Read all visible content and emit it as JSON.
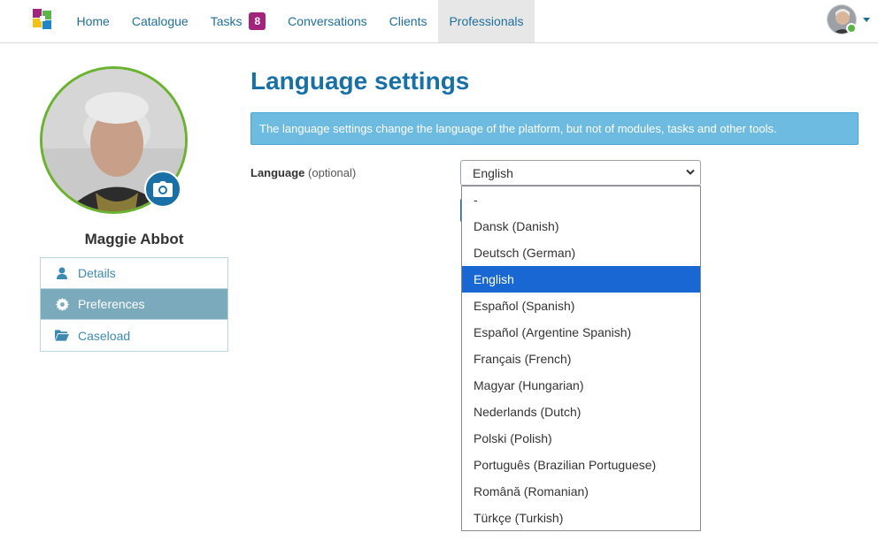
{
  "nav": {
    "items": [
      {
        "label": "Home"
      },
      {
        "label": "Catalogue"
      },
      {
        "label": "Tasks",
        "badge": "8"
      },
      {
        "label": "Conversations"
      },
      {
        "label": "Clients"
      },
      {
        "label": "Professionals"
      }
    ],
    "active": "Professionals"
  },
  "profile": {
    "name": "Maggie Abbot"
  },
  "side_menu": {
    "items": [
      {
        "label": "Details",
        "icon": "user-icon"
      },
      {
        "label": "Preferences",
        "icon": "gear-icon"
      },
      {
        "label": "Caseload",
        "icon": "folder-open-icon"
      }
    ],
    "active": "Preferences"
  },
  "main": {
    "title": "Language settings",
    "info": "The language settings change the language of the platform, but not of modules, tasks and other tools.",
    "language_label": "Language",
    "language_optional": "(optional)",
    "language_value": "English",
    "options": [
      "-",
      "Dansk (Danish)",
      "Deutsch (German)",
      "English",
      "Español (Spanish)",
      "Español (Argentine Spanish)",
      "Français (French)",
      "Magyar (Hungarian)",
      "Nederlands (Dutch)",
      "Polski (Polish)",
      "Português (Brazilian Portuguese)",
      "Română (Romanian)",
      "Türkçe (Turkish)"
    ],
    "selected_option": "English"
  },
  "colors": {
    "brand": "#1870a6",
    "badge": "#a3247d",
    "alert_bg": "#6dbbe0",
    "side_active": "#7aaabb",
    "option_selected": "#1967d2",
    "avatar_ring": "#6ab32f"
  }
}
